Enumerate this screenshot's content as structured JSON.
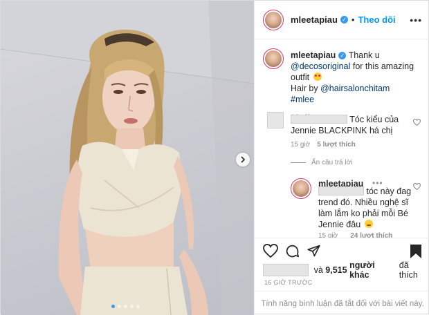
{
  "post": {
    "author": "mleetapiau",
    "follow_label": "Theo dõi",
    "separator": "•",
    "caption": {
      "line1": "Thank u",
      "mention1": "@decosoriginal",
      "line2": "for this amazing outfit",
      "line3": "Hair by",
      "mention2": "@hairsalonchitam",
      "hashtag": "#mlee",
      "time": "16 giờ"
    },
    "comments": [
      {
        "text_line": "Tóc kiểu của Jennie BLACKPINK há chị",
        "time": "15 giờ",
        "likes": "5 lượt thích",
        "hide_replies": "Ẩn câu trả lời",
        "replies": [
          {
            "author": "mleetapiau",
            "text": "tóc này đag trend đó. Nhiều nghệ sĩ làm lắm ko phải mỗi Bé Jennie đâu",
            "time": "15 giờ",
            "likes": "24 lượt thích"
          }
        ]
      }
    ],
    "likes_text": "và",
    "likes_count": "9,515",
    "likes_suffix": "người khác",
    "likes_end": "đã thích",
    "timestamp": "16 GIỜ TRƯỚC",
    "comments_disabled": "Tính năng bình luận đã tắt đối với bài viết này."
  },
  "icons": {
    "verified": "verified-badge-icon",
    "like": "heart-icon",
    "comment": "comment-bubble-icon",
    "share": "paper-plane-icon",
    "save": "bookmark-icon",
    "next": "chevron-right-icon"
  },
  "colors": {
    "accent": "#0095f6",
    "link": "#00376b",
    "muted": "#8e8e8e",
    "story_ring": "#e0316b"
  },
  "carousel": {
    "slides": 5,
    "active": 1
  }
}
